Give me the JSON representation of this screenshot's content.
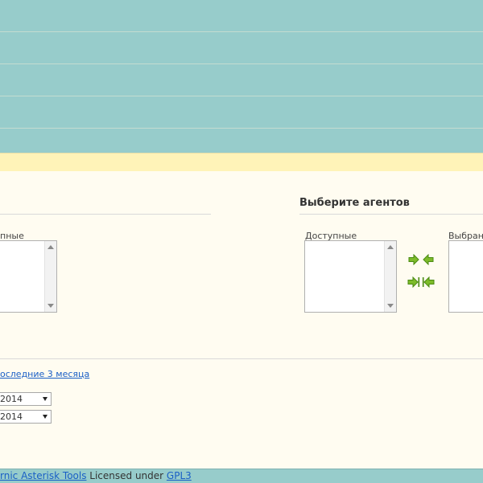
{
  "left_panel": {
    "available_label": "пные"
  },
  "agents_panel": {
    "title": "Выберите агентов",
    "available_label": "Доступные",
    "selected_label": "Выбран"
  },
  "period": {
    "last3_link": "оследние 3 месяца",
    "start_select_value": "2014",
    "end_select_value": "2014"
  },
  "footer": {
    "project_link": "rnic Asterisk Tools",
    "licensed_text": " Licensed under ",
    "license_link": "GPL3"
  },
  "colors": {
    "header_teal": "#97cccb",
    "notice_yellow": "#fff3b8",
    "content_bg": "#fffcf1",
    "link_blue": "#1a5fc6",
    "arrow_green": "#7dbb2a"
  },
  "icons": [
    "add-arrow-icon",
    "remove-arrow-icon",
    "add-all-icon",
    "remove-all-icon"
  ]
}
